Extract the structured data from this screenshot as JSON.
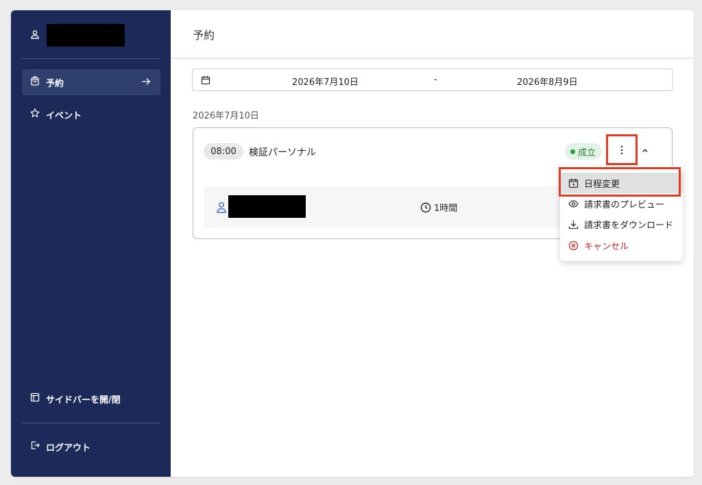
{
  "colors": {
    "sidebar_bg": "#1b2a58",
    "sidebar_active": "#2f3f6e",
    "status_green": "#2e7d32",
    "danger_red": "#c62828",
    "highlight_border": "#e53a1f"
  },
  "sidebar": {
    "user_icon": "person-icon",
    "nav": [
      {
        "label": "予約",
        "icon": "shopping-bag-icon",
        "active": true
      },
      {
        "label": "イベント",
        "icon": "star-icon",
        "active": false
      }
    ],
    "toggle_label": "サイドバーを開/閉",
    "logout_label": "ログアウト"
  },
  "header": {
    "title": "予約"
  },
  "date_range": {
    "from": "2026年7月10日",
    "separator": "-",
    "to": "2026年8月9日"
  },
  "bookings": {
    "date_label": "2026年7月10日",
    "card": {
      "time": "08:00",
      "title": "検証パーソナル",
      "status": "成立",
      "duration": "1時間"
    }
  },
  "menu": {
    "items": [
      {
        "label": "日程変更",
        "icon": "calendar-clock-icon"
      },
      {
        "label": "請求書のプレビュー",
        "icon": "eye-icon"
      },
      {
        "label": "請求書をダウンロード",
        "icon": "download-icon"
      },
      {
        "label": "キャンセル",
        "icon": "cancel-circle-icon"
      }
    ]
  }
}
